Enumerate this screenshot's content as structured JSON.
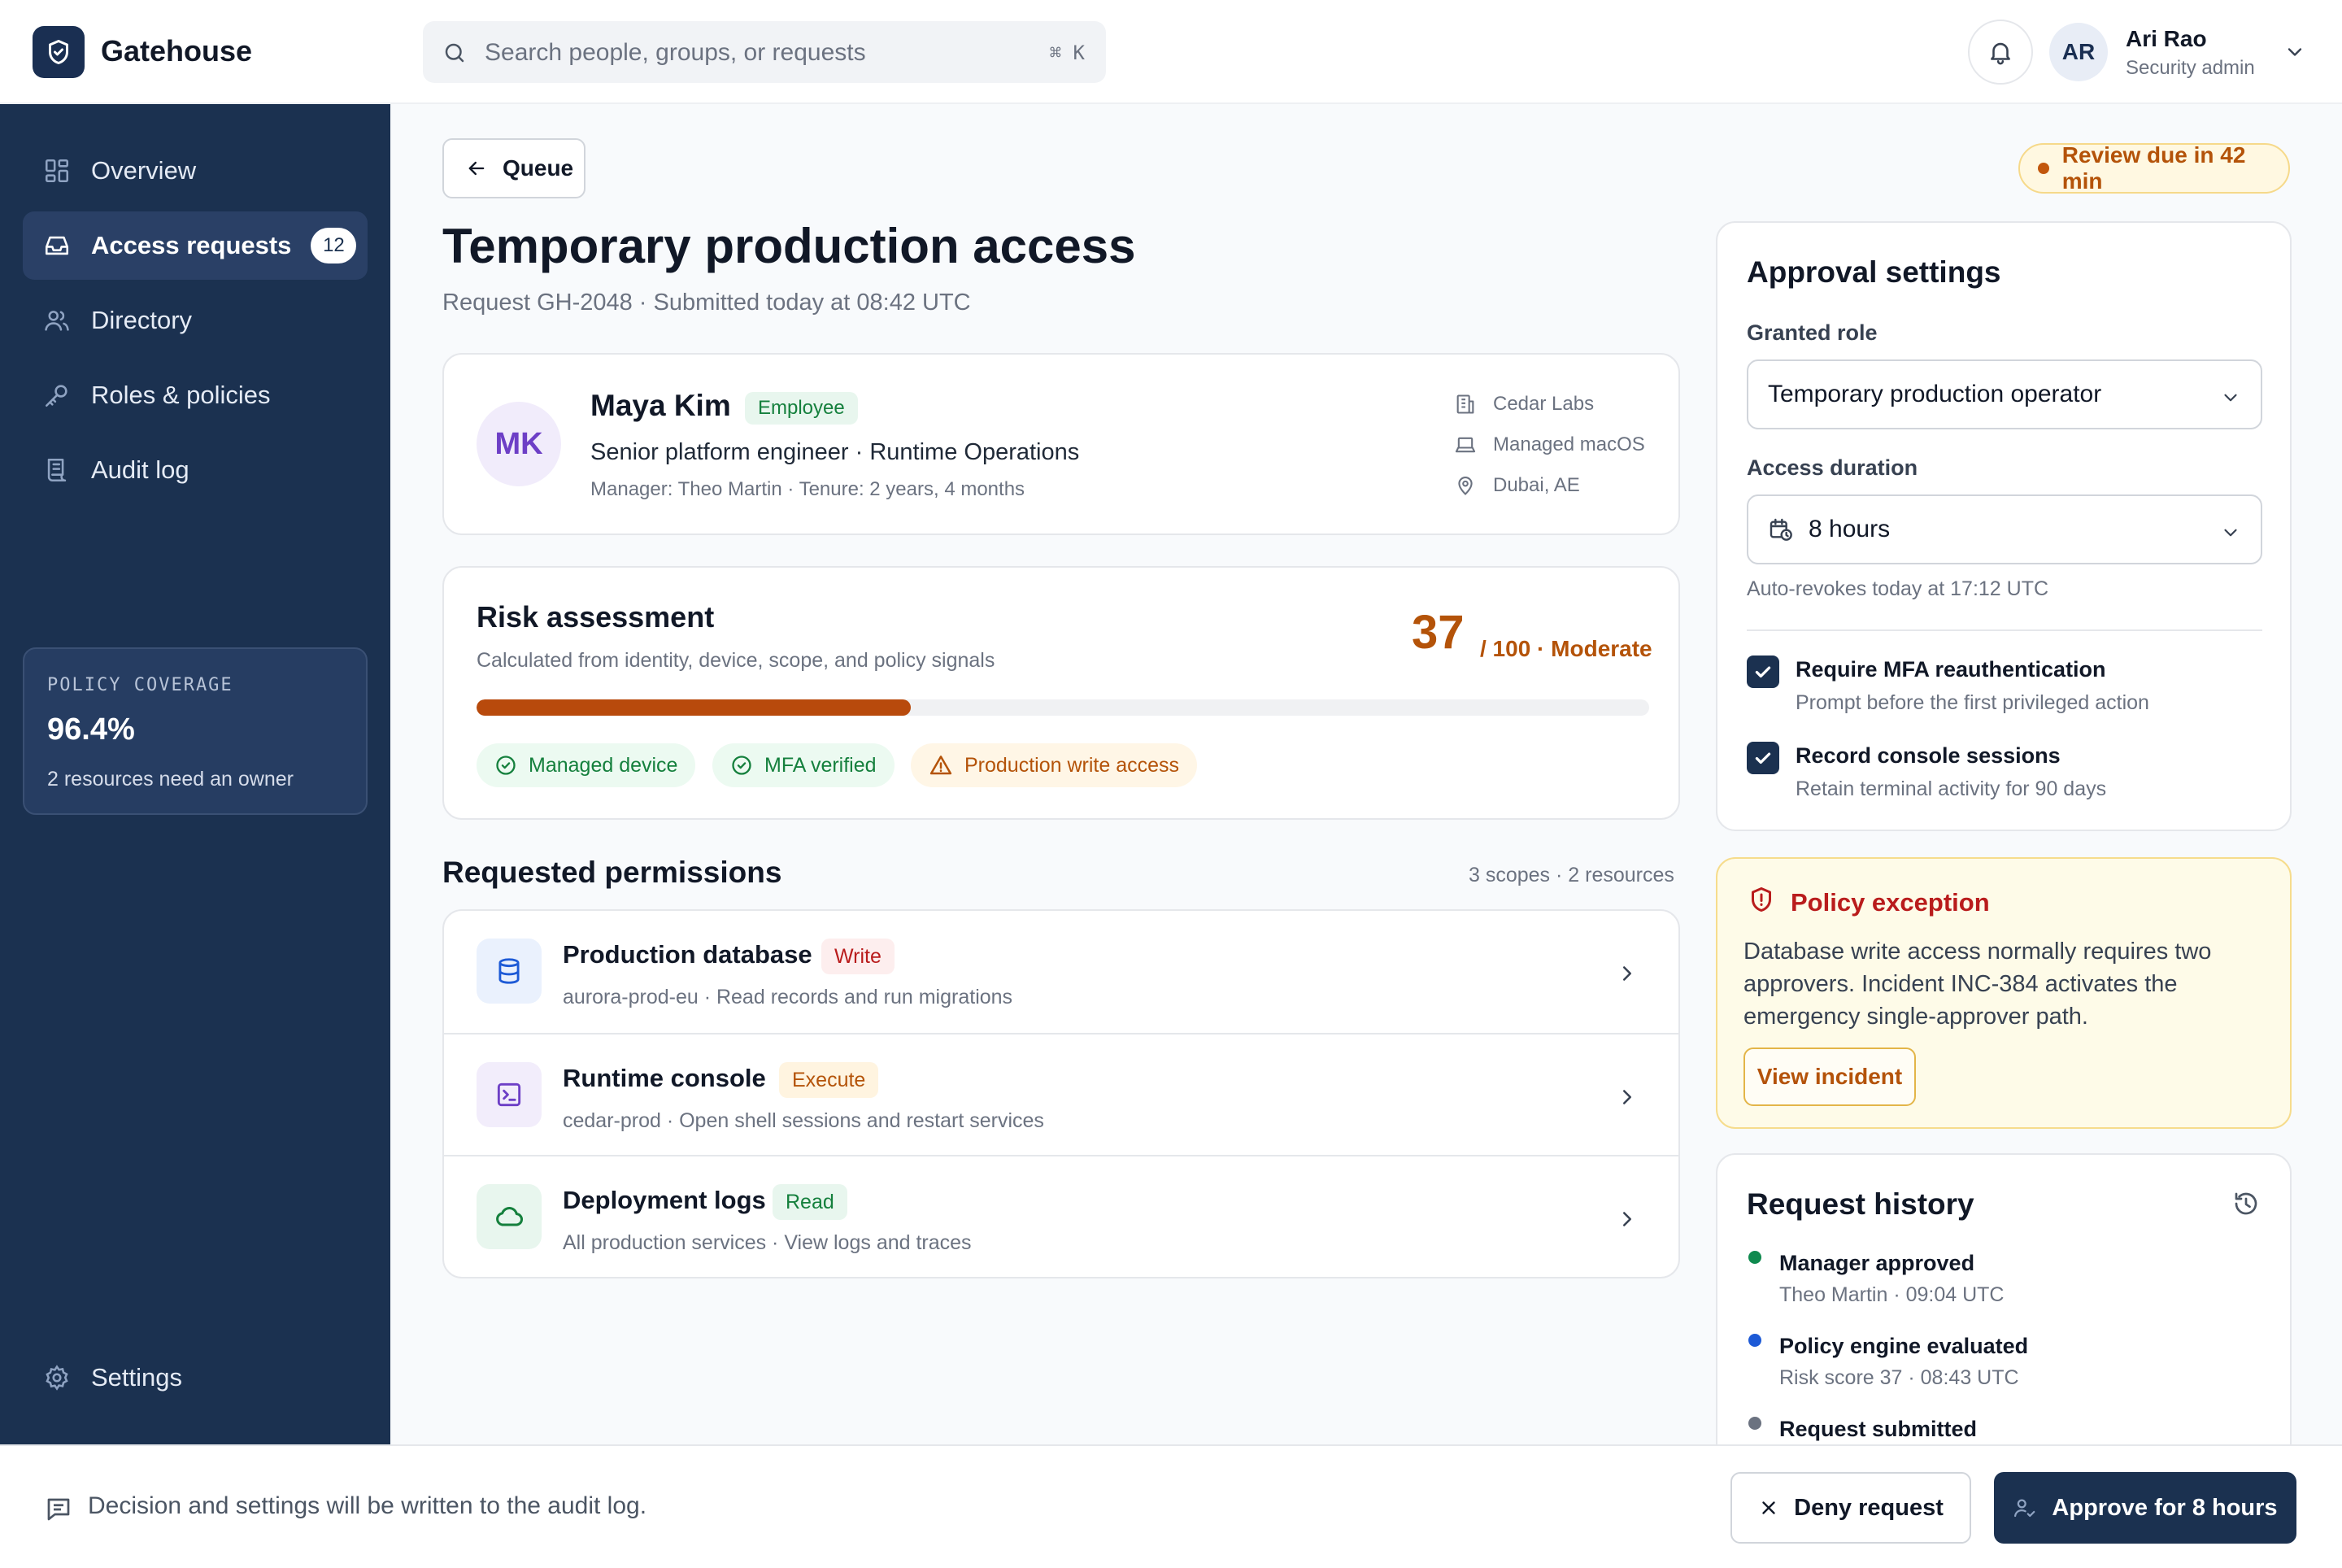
{
  "app": {
    "name": "Gatehouse"
  },
  "search": {
    "placeholder": "Search people, groups, or requests",
    "shortcut": "⌘ K"
  },
  "user": {
    "initials": "AR",
    "name": "Ari Rao",
    "role": "Security admin"
  },
  "sidebar": {
    "items": [
      {
        "label": "Overview",
        "icon": "grid-icon"
      },
      {
        "label": "Access requests",
        "icon": "inbox-icon",
        "badge": "12",
        "active": true
      },
      {
        "label": "Directory",
        "icon": "users-icon"
      },
      {
        "label": "Roles & policies",
        "icon": "key-icon"
      },
      {
        "label": "Audit log",
        "icon": "audit-log-icon"
      }
    ],
    "policy": {
      "label": "POLICY COVERAGE",
      "value": "96.4%",
      "note": "2 resources need an owner"
    },
    "settings_label": "Settings"
  },
  "header": {
    "back_label": "Queue",
    "due_badge": "Review due in 42 min",
    "title": "Temporary production access",
    "subtitle": "Request GH-2048 · Submitted today at 08:42 UTC"
  },
  "requester": {
    "initials": "MK",
    "name": "Maya Kim",
    "badge": "Employee",
    "title": "Senior platform engineer · Runtime Operations",
    "meta": "Manager: Theo Martin · Tenure: 2 years, 4 months",
    "facts": [
      {
        "icon": "building-icon",
        "text": "Cedar Labs"
      },
      {
        "icon": "laptop-icon",
        "text": "Managed macOS"
      },
      {
        "icon": "location-pin-icon",
        "text": "Dubai, AE"
      }
    ]
  },
  "risk": {
    "title": "Risk assessment",
    "subtitle": "Calculated from identity, device, scope, and policy signals",
    "score": "37",
    "score_rest": "/ 100 · Moderate",
    "fraction": 0.37,
    "chips": [
      {
        "label": "Managed device",
        "kind": "ok"
      },
      {
        "label": "MFA verified",
        "kind": "ok"
      },
      {
        "label": "Production write access",
        "kind": "warn"
      }
    ]
  },
  "permissions": {
    "heading": "Requested permissions",
    "count": "3 scopes · 2 resources",
    "items": [
      {
        "name": "Production database",
        "badge": "Write",
        "desc": "aurora-prod-eu · Read records and run migrations",
        "icon": "database-icon"
      },
      {
        "name": "Runtime console",
        "badge": "Execute",
        "desc": "cedar-prod · Open shell sessions and restart services",
        "icon": "terminal-icon"
      },
      {
        "name": "Deployment logs",
        "badge": "Read",
        "desc": "All production services · View logs and traces",
        "icon": "cloud-icon"
      }
    ]
  },
  "settings": {
    "title": "Approval settings",
    "role_label": "Granted role",
    "role_value": "Temporary production operator",
    "duration_label": "Access duration",
    "duration_value": "8 hours",
    "auto_revoke": "Auto-revokes today at 17:12 UTC",
    "checks": [
      {
        "label": "Require MFA reauthentication",
        "sub": "Prompt before the first privileged action",
        "checked": true
      },
      {
        "label": "Record console sessions",
        "sub": "Retain terminal activity for 90 days",
        "checked": true
      }
    ]
  },
  "exception": {
    "title": "Policy exception",
    "body": "Database write access normally requires two approvers. Incident INC-384 activates the emergency single-approver path.",
    "button": "View incident"
  },
  "history": {
    "title": "Request history",
    "events": [
      {
        "label": "Manager approved",
        "meta": "Theo Martin · 09:04 UTC",
        "color": "#0f8a4f"
      },
      {
        "label": "Policy engine evaluated",
        "meta": "Risk score 37 · 08:43 UTC",
        "color": "#1d5ad6"
      },
      {
        "label": "Request submitted",
        "meta": "",
        "color": "#6b7280"
      }
    ]
  },
  "footer": {
    "note": "Decision and settings will be written to the audit log.",
    "deny_label": "Deny request",
    "approve_label": "Approve for 8 hours"
  },
  "colors": {
    "brand": "#1b3150",
    "warning": "#b45309",
    "success": "#15803d",
    "danger": "#b91c1c"
  }
}
